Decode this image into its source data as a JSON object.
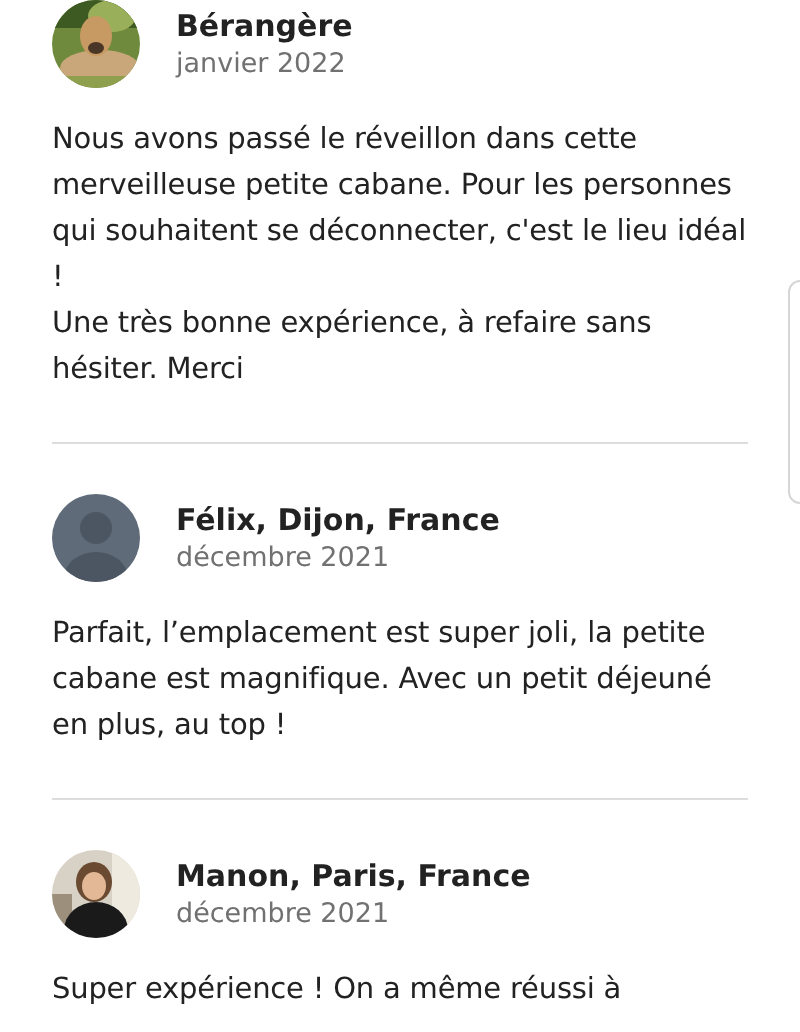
{
  "reviews": [
    {
      "author": "Bérangère",
      "date": "janvier 2022",
      "avatar": {
        "kind": "picture"
      },
      "paragraphs": [
        "Nous avons passé le réveillon dans cette merveilleuse petite cabane. Pour les personnes qui souhaitent se déconnecter, c'est le lieu idéal !",
        "Une très bonne expérience, à refaire sans hésiter. Merci"
      ]
    },
    {
      "author": "Félix, Dijon, France",
      "date": "décembre 2021",
      "avatar": {
        "kind": "default"
      },
      "paragraphs": [
        "Parfait, l’emplacement est super joli, la petite cabane est magnifique. Avec un petit déjeuné en plus, au top !"
      ]
    },
    {
      "author": "Manon, Paris, France",
      "date": "décembre 2021",
      "avatar": {
        "kind": "picture"
      },
      "paragraphs": [
        "Super expérience ! On a même réussi à"
      ]
    }
  ]
}
